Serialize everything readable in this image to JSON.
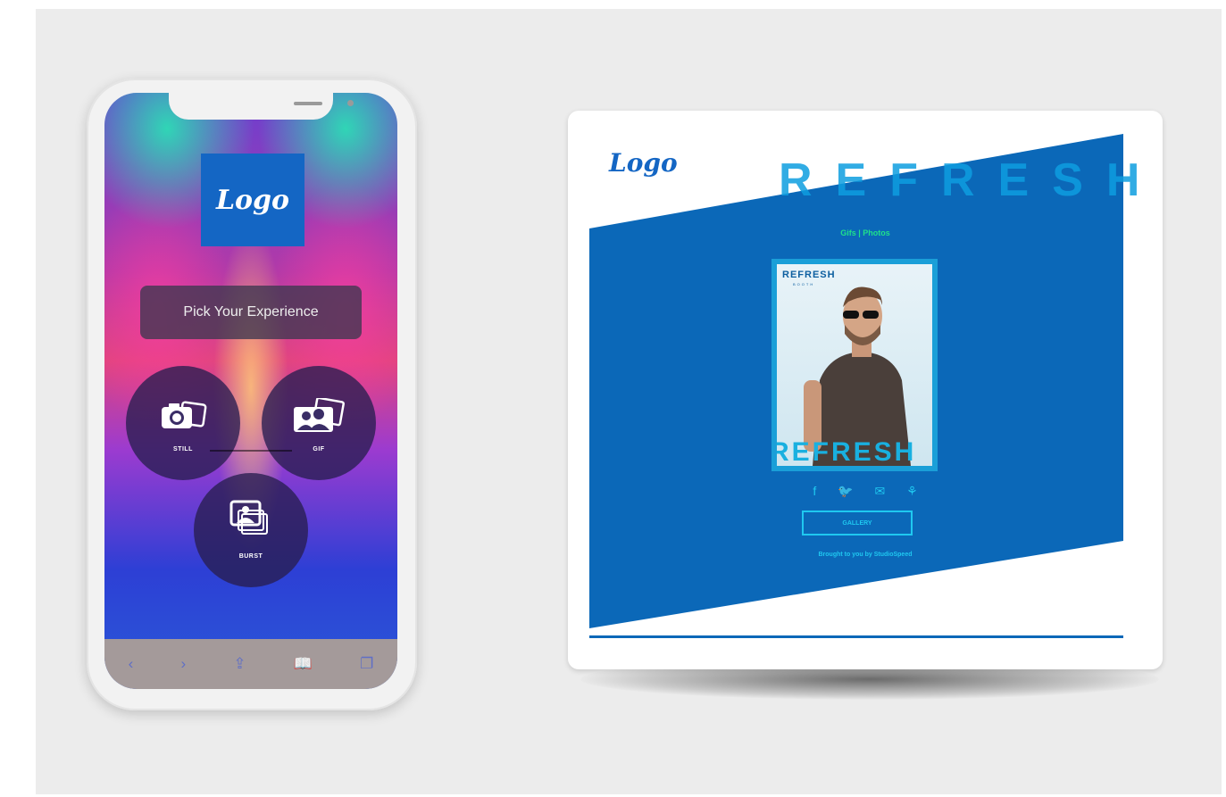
{
  "phone": {
    "logo": "Logo",
    "prompt": "Pick Your Experience",
    "options": [
      {
        "label": "STILL",
        "icon": "camera-icon"
      },
      {
        "label": "GIF",
        "icon": "gif-people-icon"
      },
      {
        "label": "BURST",
        "icon": "burst-photos-icon"
      }
    ],
    "toolbar": {
      "back": "‹",
      "forward": "›",
      "share": "⇪",
      "bookmarks": "📖",
      "tabs": "❐"
    }
  },
  "gallery_page": {
    "logo": "Logo",
    "banner_text": "REFRESH",
    "nav": "Gifs  |  Photos",
    "photo": {
      "brand": "REFRESH",
      "brand_sub": "BOOTH",
      "overlay": "REFRESH"
    },
    "social": [
      "f",
      "🐦",
      "✉",
      "⚘"
    ],
    "gallery_button": "GALLERY",
    "brought_by": "Brought to you by StudioSpeed"
  },
  "colors": {
    "brand_blue": "#1466c4",
    "accent_cyan": "#1fc8f0",
    "nav_green": "#1fe08b"
  }
}
